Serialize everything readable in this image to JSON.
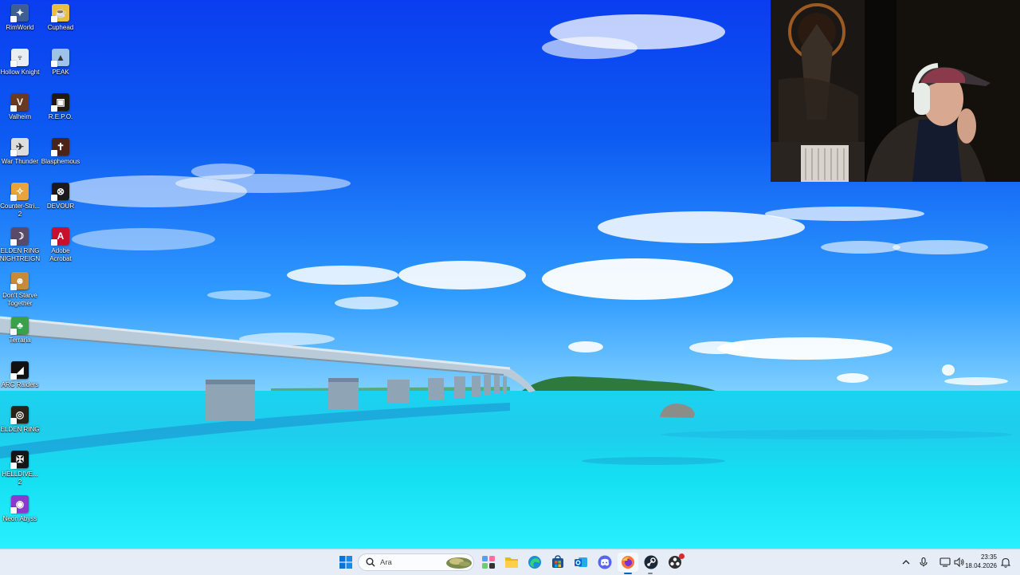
{
  "desktop": {
    "icons_col1": [
      {
        "label": "RimWorld",
        "icon": "rimworld-icon",
        "color": "#3d5f93"
      },
      {
        "label": "Hollow Knight",
        "icon": "hollow-knight-icon",
        "color": "#e9eef3"
      },
      {
        "label": "Valheim",
        "icon": "valheim-icon",
        "color": "#6a3a20"
      },
      {
        "label": "War Thunder",
        "icon": "war-thunder-icon",
        "color": "#dddddd"
      },
      {
        "label": "Counter-Stri... 2",
        "icon": "counter-strike-icon",
        "color": "#e8a33a"
      },
      {
        "label": "ELDEN RING NIGHTREIGN",
        "icon": "elden-ring-nightreign-icon",
        "color": "#5a4a6a"
      },
      {
        "label": "Don't Starve Together",
        "icon": "dont-starve-icon",
        "color": "#c78a3a"
      },
      {
        "label": "Terraria",
        "icon": "terraria-icon",
        "color": "#3aa04a"
      },
      {
        "label": "ARC Raiders",
        "icon": "arc-raiders-icon",
        "color": "#111111"
      },
      {
        "label": "ELDEN RING",
        "icon": "elden-ring-icon",
        "color": "#2a2418"
      },
      {
        "label": "HELLDIVE... 2",
        "icon": "helldivers-icon",
        "color": "#151515"
      },
      {
        "label": "Neon Abyss",
        "icon": "neon-abyss-icon",
        "color": "#8a3ad0"
      }
    ],
    "icons_col2": [
      {
        "label": "Cuphead",
        "icon": "cuphead-icon",
        "color": "#e8c040"
      },
      {
        "label": "PEAK",
        "icon": "peak-icon",
        "color": "#9ec3e8"
      },
      {
        "label": "R.E.P.O.",
        "icon": "repo-icon",
        "color": "#201a10"
      },
      {
        "label": "Blasphemous",
        "icon": "blasphemous-icon",
        "color": "#4a2418"
      },
      {
        "label": "DEVOUR",
        "icon": "devour-icon",
        "color": "#1a1a1a"
      },
      {
        "label": "Adobe Acrobat",
        "icon": "adobe-acrobat-icon",
        "color": "#c8102e"
      }
    ]
  },
  "taskbar": {
    "search_placeholder": "Ara",
    "time": "23:35",
    "date": "18.04.2026",
    "apps": [
      "start-icon",
      "search-icon",
      "widgets-icon",
      "copilot-icon",
      "file-explorer-icon",
      "edge-icon",
      "microsoft-store-icon",
      "outlook-icon",
      "discord-icon",
      "firefox-icon",
      "steam-icon",
      "obs-icon"
    ],
    "colors": {
      "accent": "#0067c0",
      "firefox": "#ff7139",
      "discord": "#5865f2"
    }
  }
}
